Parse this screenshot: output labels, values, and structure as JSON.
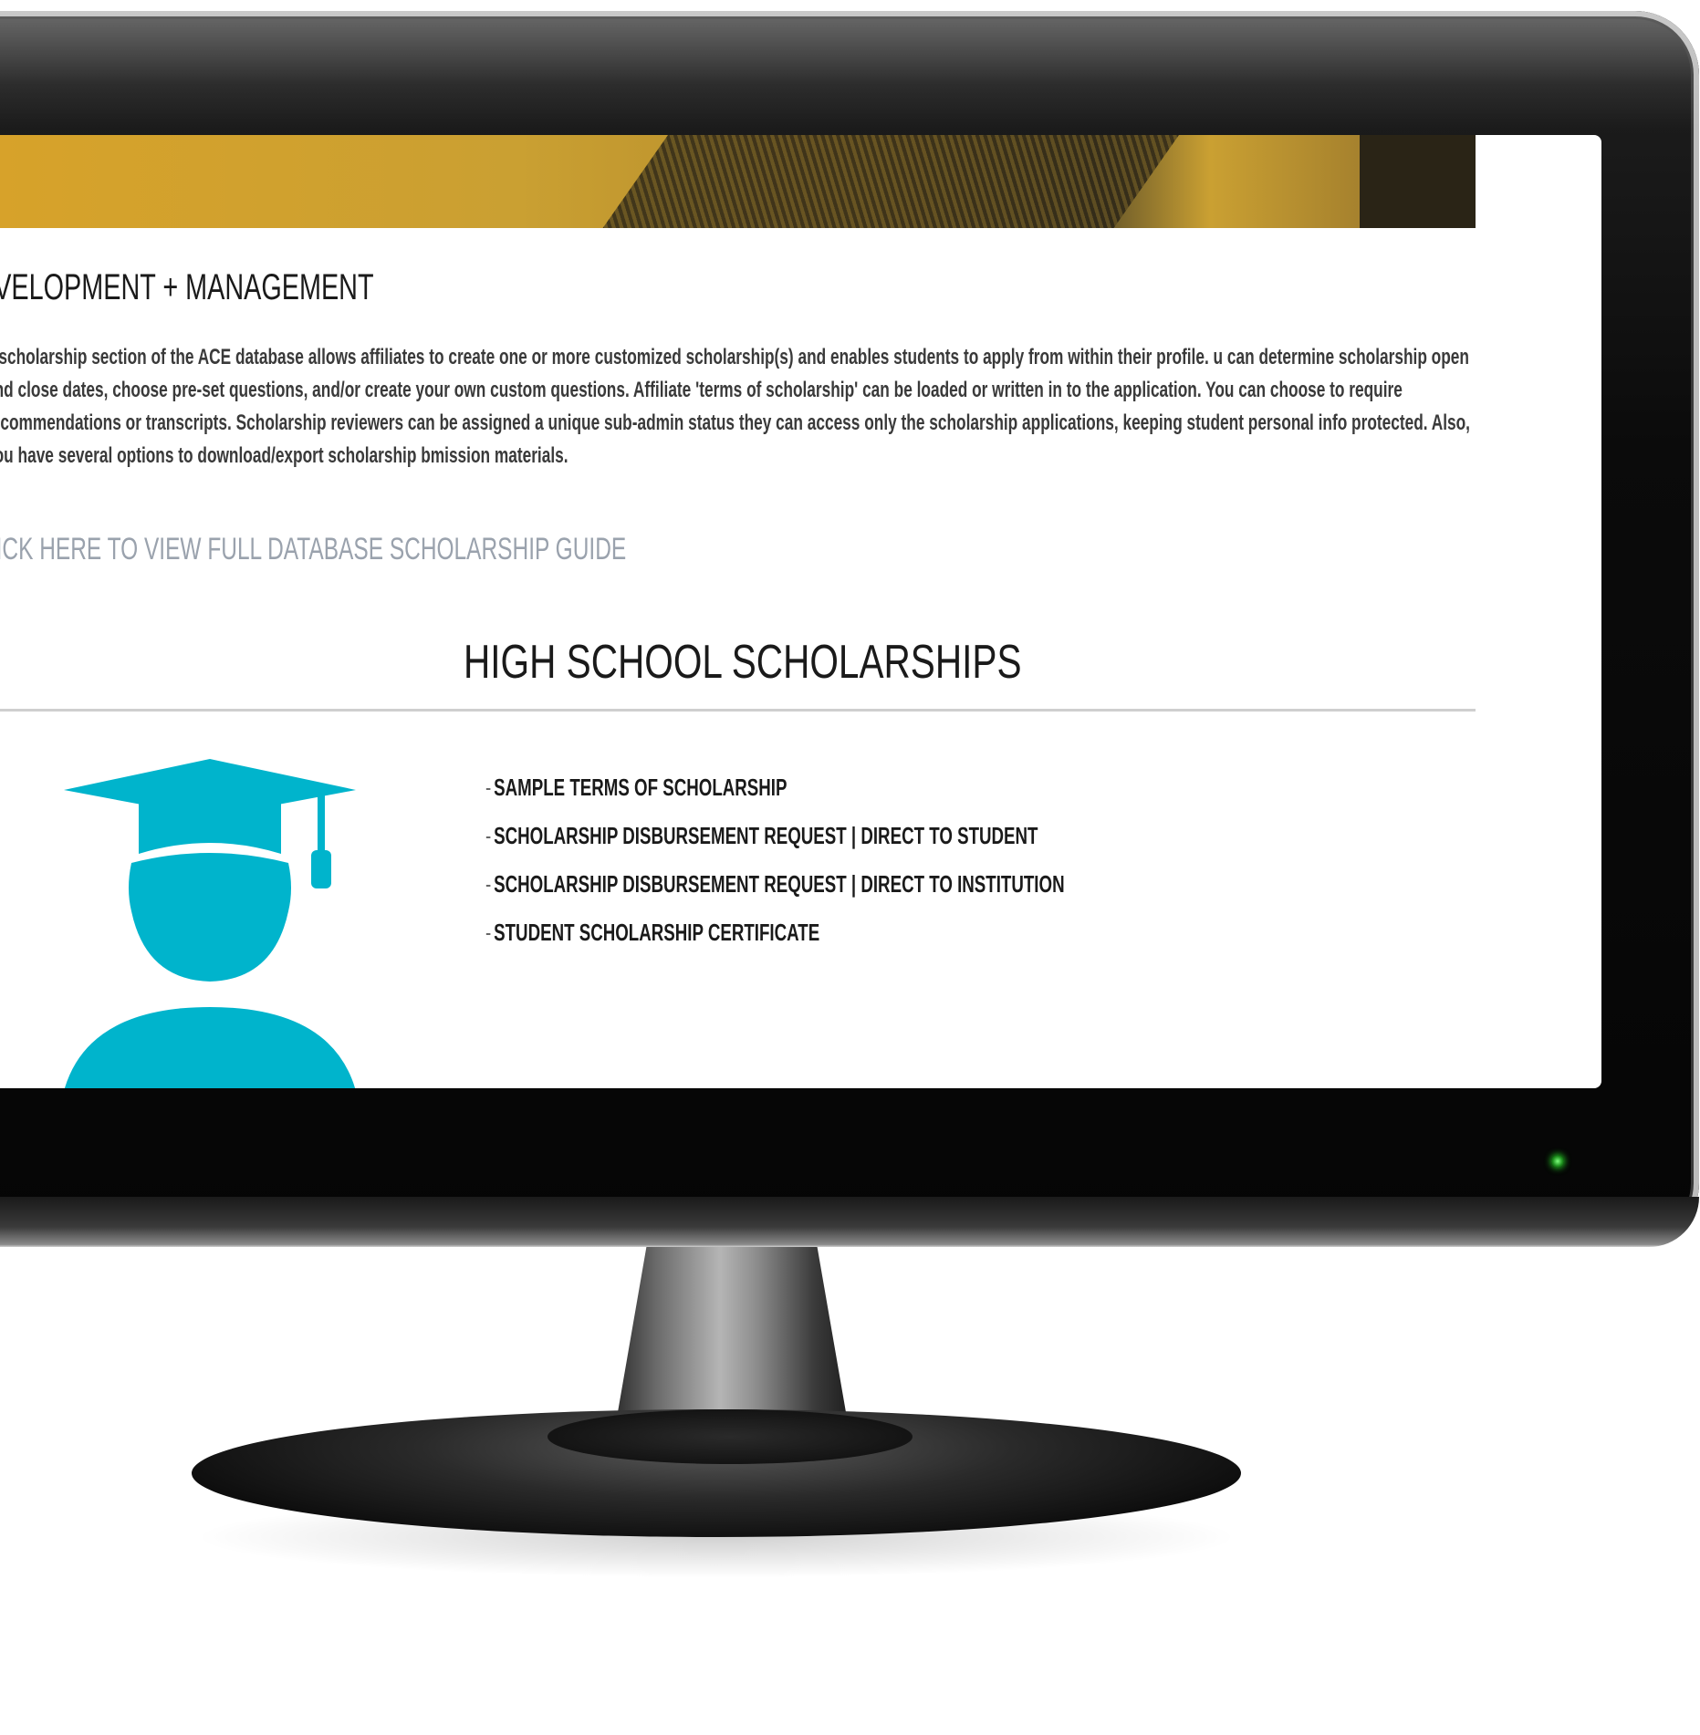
{
  "page": {
    "section_heading": "EVELOPMENT + MANAGEMENT",
    "description": "e scholarship section of the ACE database allows affiliates to create one or more customized scholarship(s) and enables students to apply from within their profile. u can determine scholarship open and close dates, choose pre-set questions, and/or create your own custom questions. Affiliate 'terms of scholarship' can be loaded or written in to the application. You can choose to require recommendations or transcripts. Scholarship reviewers can be assigned a unique sub-admin status they can access only the scholarship applications, keeping student personal info protected. Also, you have several options to download/export scholarship bmission materials.",
    "guide_link": "LICK HERE TO VIEW FULL DATABASE SCHOLARSHIP GUIDE",
    "hs_title": "HIGH SCHOOL SCHOLARSHIPS",
    "documents": [
      "SAMPLE TERMS OF SCHOLARSHIP",
      "SCHOLARSHIP DISBURSEMENT REQUEST | DIRECT TO STUDENT",
      "SCHOLARSHIP DISBURSEMENT REQUEST | DIRECT TO INSTITUTION",
      "STUDENT SCHOLARSHIP CERTIFICATE"
    ],
    "document_prefix": "-"
  },
  "icons": {
    "graduate": "graduate-student-icon",
    "power_led": "power-indicator-icon"
  },
  "colors": {
    "banner": "#d7a22a",
    "icon": "#00b4cc",
    "link": "#9aa2ad",
    "led": "#2aff2a"
  }
}
